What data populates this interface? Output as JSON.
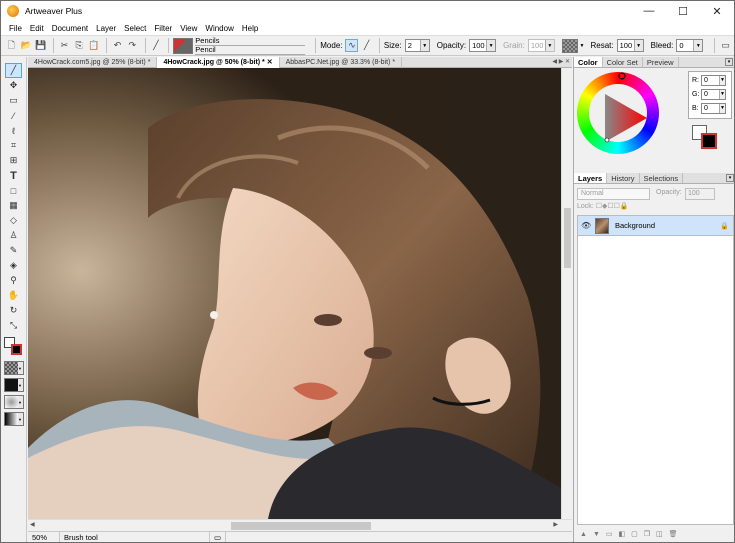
{
  "window": {
    "title": "Artweaver Plus",
    "min_glyph": "—",
    "max_glyph": "☐",
    "close_glyph": "✕"
  },
  "menu": [
    "File",
    "Edit",
    "Document",
    "Layer",
    "Select",
    "Filter",
    "View",
    "Window",
    "Help"
  ],
  "options": {
    "brush_category": "Pencils",
    "brush_name": "Pencil",
    "mode_label": "Mode:",
    "size_label": "Size:",
    "size_value": "2",
    "opacity_label": "Opacity:",
    "opacity_value": "100",
    "grain_label": "Grain:",
    "grain_value": "100",
    "resat_label": "Resat:",
    "resat_value": "100",
    "bleed_label": "Bleed:",
    "bleed_value": "0"
  },
  "tabs": [
    {
      "label": "4HowCrack.com5.jpg @ 25% (8-bit) *"
    },
    {
      "label": "4HowCrack.jpg @ 50% (8-bit) *"
    },
    {
      "label": "AbbasPC.Net.jpg @ 33.3% (8-bit) *"
    }
  ],
  "status": {
    "zoom": "50%",
    "tool": "Brush tool"
  },
  "color_panel": {
    "tabs": [
      "Color",
      "Color Set",
      "Preview"
    ],
    "r_label": "R:",
    "r_value": "0",
    "g_label": "G:",
    "g_value": "0",
    "b_label": "B:",
    "b_value": "0"
  },
  "layers_panel": {
    "tabs": [
      "Layers",
      "History",
      "Selections"
    ],
    "blend_mode": "Normal",
    "opacity_label": "Opacity:",
    "opacity_value": "100",
    "lock_label": "Lock:",
    "layers": [
      {
        "name": "Background"
      }
    ]
  }
}
